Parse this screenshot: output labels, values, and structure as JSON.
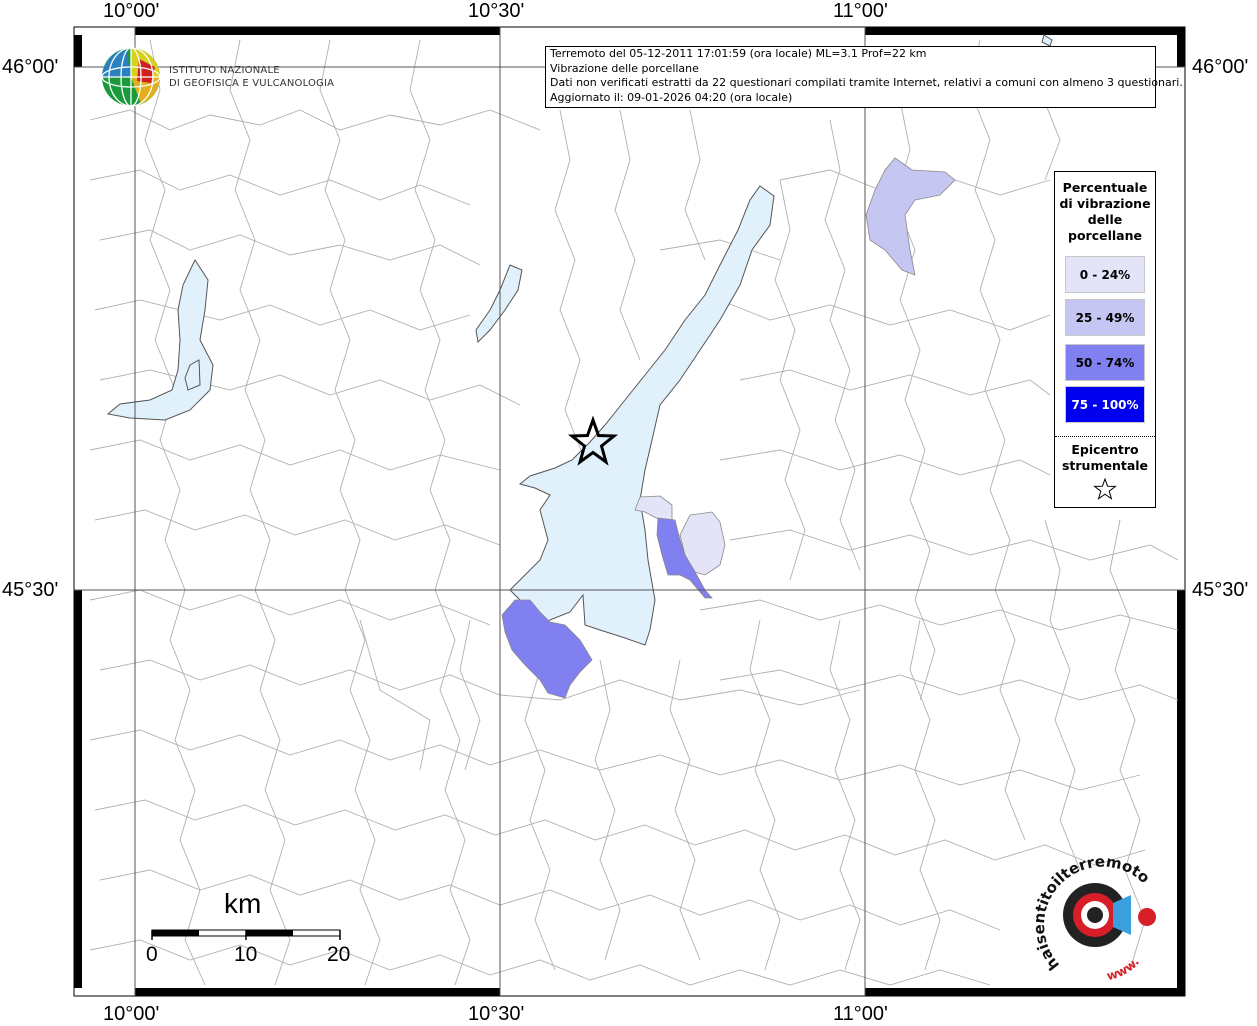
{
  "header": {
    "lines": [
      "Terremoto del 05-12-2011 17:01:59 (ora locale) ML=3.1 Prof=22 km",
      "Vibrazione delle porcellane",
      "Dati non verificati estratti da 22 questionari compilati tramite Internet, relativi a comuni con almeno 3 questionari.",
      "Aggiornato il: 09-01-2026 04:20 (ora locale)"
    ]
  },
  "institute": {
    "line1": "ISTITUTO NAZIONALE",
    "line2": "DI GEOFISICA E VULCANOLOGIA"
  },
  "axes": {
    "lon_labels": [
      "10°00'",
      "10°30'",
      "11°00'"
    ],
    "lat_labels": [
      "46°00'",
      "45°30'"
    ]
  },
  "legend": {
    "title_lines": [
      "Percentuale",
      "di vibrazione",
      "delle",
      "porcellane"
    ],
    "classes": [
      {
        "label": "0 - 24%",
        "color": "#e4e4f8",
        "text_color": "#000000"
      },
      {
        "label": "25 - 49%",
        "color": "#c6c6f2",
        "text_color": "#000000"
      },
      {
        "label": "50 - 74%",
        "color": "#8080f0",
        "text_color": "#000000"
      },
      {
        "label": "75 - 100%",
        "color": "#0000ee",
        "text_color": "#ffffff"
      }
    ],
    "epicenter_lines": [
      "Epicentro",
      "strumentale"
    ]
  },
  "scale": {
    "unit": "km",
    "ticks": [
      "0",
      "10",
      "20"
    ]
  },
  "watermark": {
    "text": "haisentitoilterremoto.it",
    "url_part": "www."
  },
  "colors": {
    "lake": "#e1f1fb",
    "border": "#a8a8a8",
    "grid": "#555555",
    "frame": "#000000"
  }
}
